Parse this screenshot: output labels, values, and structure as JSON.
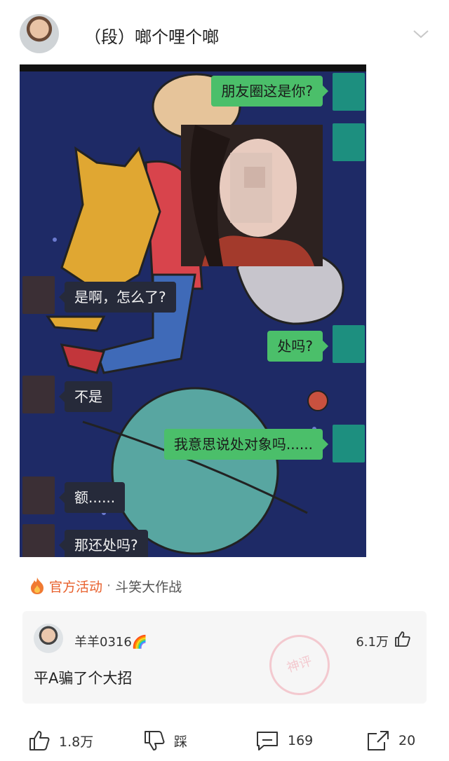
{
  "header": {
    "author": "（段）啷个哩个啷",
    "expand_icon": "chevron-down-icon"
  },
  "chat": {
    "messages": [
      {
        "side": "right",
        "text": "朋友圈这是你?"
      },
      {
        "side": "left",
        "text": "是啊，怎么了?"
      },
      {
        "side": "right",
        "text": "处吗?"
      },
      {
        "side": "left",
        "text": "不是"
      },
      {
        "side": "right",
        "text": "我意思说处对象吗......"
      },
      {
        "side": "left",
        "text": "额......"
      },
      {
        "side": "left",
        "text": "那还处吗?"
      }
    ]
  },
  "activity": {
    "icon": "fire-icon",
    "label": "官方活动",
    "separator": "·",
    "name": "斗笑大作战"
  },
  "comment": {
    "user": "羊羊0316🌈",
    "likes": "6.1万",
    "text": "平A骗了个大招",
    "like_icon": "thumb-up-icon"
  },
  "actions": {
    "like": "1.8万",
    "dislike": "踩",
    "comments": "169",
    "share": "20"
  },
  "colors": {
    "accent": "#e8602c",
    "chat_green": "#4bbf6a",
    "chat_bg": "#1e2a66"
  }
}
